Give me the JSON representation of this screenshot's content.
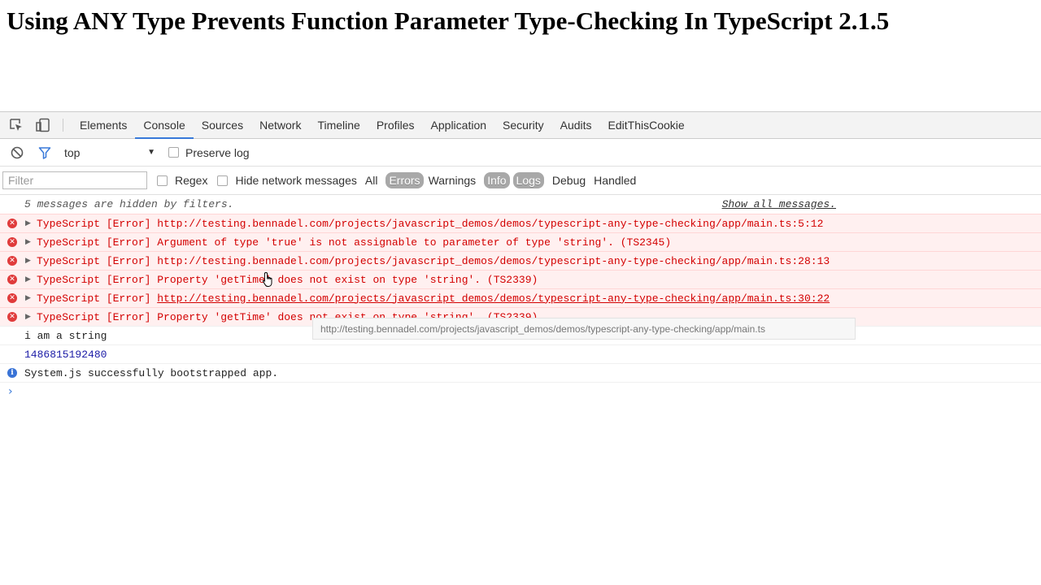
{
  "page": {
    "heading": "Using ANY Type Prevents Function Parameter Type-Checking In TypeScript 2.1.5"
  },
  "devtools": {
    "toolbar_icons": [
      "inspect-element-icon",
      "device-toolbar-icon"
    ],
    "tabs": [
      {
        "label": "Elements",
        "active": false
      },
      {
        "label": "Console",
        "active": true
      },
      {
        "label": "Sources",
        "active": false
      },
      {
        "label": "Network",
        "active": false
      },
      {
        "label": "Timeline",
        "active": false
      },
      {
        "label": "Profiles",
        "active": false
      },
      {
        "label": "Application",
        "active": false
      },
      {
        "label": "Security",
        "active": false
      },
      {
        "label": "Audits",
        "active": false
      },
      {
        "label": "EditThisCookie",
        "active": false
      }
    ],
    "context": {
      "selected": "top",
      "preserve_log_label": "Preserve log",
      "preserve_log_checked": false
    },
    "filter": {
      "placeholder": "Filter",
      "value": "",
      "regex_label": "Regex",
      "hide_network_label": "Hide network messages",
      "levels": [
        {
          "label": "All",
          "selected": false
        },
        {
          "label": "Errors",
          "selected": true
        },
        {
          "label": "Warnings",
          "selected": false
        },
        {
          "label": "Info",
          "selected": true
        },
        {
          "label": "Logs",
          "selected": true
        },
        {
          "label": "Debug",
          "selected": false
        },
        {
          "label": "Handled",
          "selected": false
        }
      ]
    },
    "console": {
      "hidden_notice": "5 messages are hidden by filters.",
      "show_all_label": "Show all messages.",
      "messages": [
        {
          "type": "error",
          "prefix": "TypeScript [Error] ",
          "text": "http://testing.bennadel.com/projects/javascript_demos/demos/typescript-any-type-checking/app/main.ts:5:12",
          "is_link": true,
          "underline": false
        },
        {
          "type": "error",
          "prefix": "TypeScript [Error] ",
          "text": "Argument of type 'true' is not assignable to parameter of type 'string'. (TS2345)",
          "is_link": false,
          "underline": false
        },
        {
          "type": "error",
          "prefix": "TypeScript [Error] ",
          "text": "http://testing.bennadel.com/projects/javascript_demos/demos/typescript-any-type-checking/app/main.ts:28:13",
          "is_link": true,
          "underline": false
        },
        {
          "type": "error",
          "prefix": "TypeScript [Error] ",
          "text": "Property 'getTime' does not exist on type 'string'. (TS2339)",
          "is_link": false,
          "underline": false
        },
        {
          "type": "error",
          "prefix": "TypeScript [Error] ",
          "text": "http://testing.bennadel.com/projects/javascript_demos/demos/typescript-any-type-checking/app/main.ts:30:22",
          "is_link": true,
          "underline": true
        },
        {
          "type": "error",
          "prefix": "TypeScript [Error] ",
          "text": "Property 'getTime' does not exist on type 'string'. (TS2339)",
          "is_link": false,
          "underline": false
        },
        {
          "type": "log",
          "text": "i am a string"
        },
        {
          "type": "number",
          "text": "1486815192480"
        },
        {
          "type": "info",
          "text": "System.js successfully bootstrapped app."
        }
      ],
      "tooltip": "http://testing.bennadel.com/projects/javascript_demos/demos/typescript-any-type-checking/app/main.ts"
    }
  },
  "colors": {
    "error_text": "#d30000",
    "error_bg": "#fff0f0",
    "accent": "#3879d9",
    "number_text": "#1a1aa6"
  }
}
